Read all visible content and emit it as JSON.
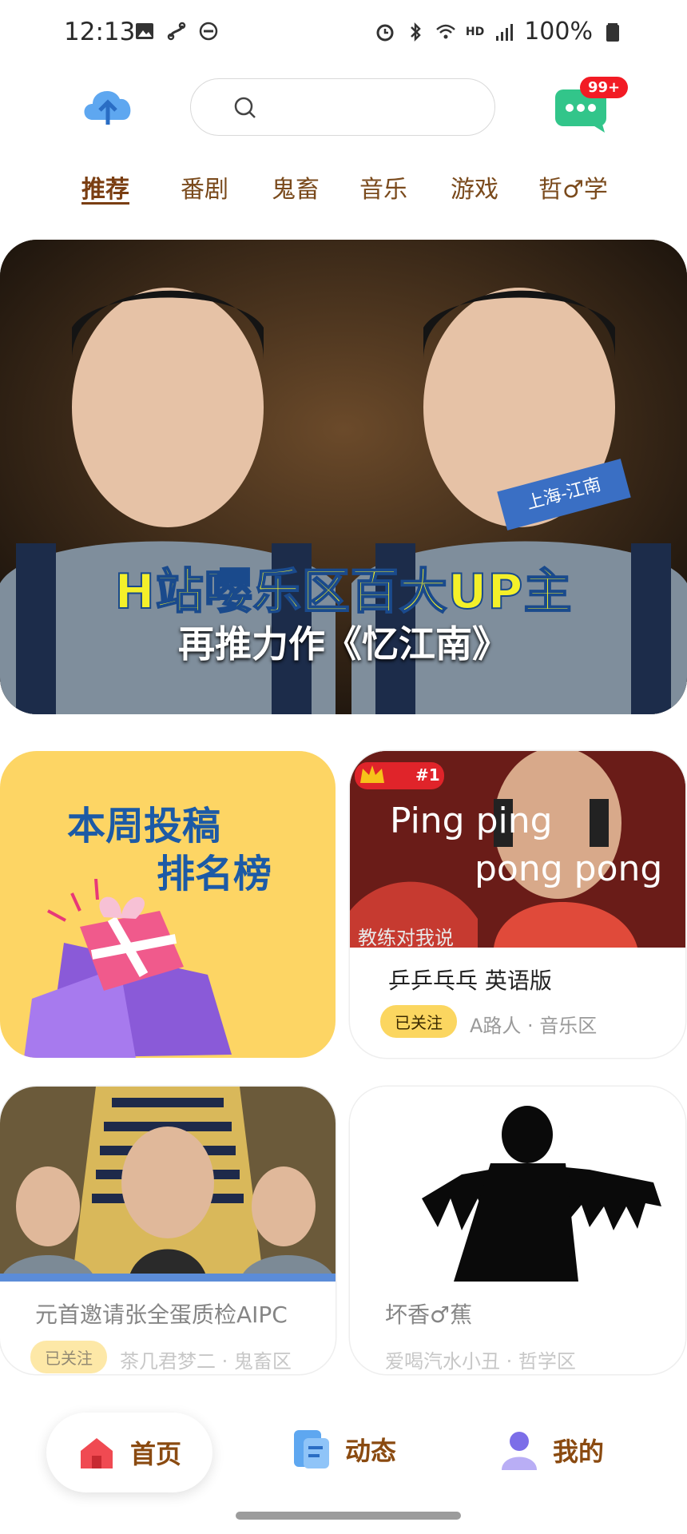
{
  "status_bar": {
    "time": "12:13",
    "network": "HD",
    "battery": "100%"
  },
  "top_bar": {
    "message_badge": "99+"
  },
  "tabs": [
    "推荐",
    "番剧",
    "鬼畜",
    "音乐",
    "游戏",
    "哲♂学"
  ],
  "hero": {
    "line1": "H站嘤乐区百大UP主",
    "line2": "再推力作《忆江南》",
    "tag": "上海-江南"
  },
  "rank_card": {
    "line1": "本周投稿",
    "line2": "排名榜"
  },
  "videos": [
    {
      "thumb_overlay_line1": "Ping ping",
      "thumb_overlay_line2": "pong pong",
      "thumb_caption": "教练对我说",
      "rank": "#1",
      "title": "乒乒乓乓 英语版",
      "follow": "已关注",
      "meta": "A路人 · 音乐区"
    },
    {
      "title": "元首邀请张全蛋质检AIPC",
      "follow": "已关注",
      "meta": "茶几君梦二 · 鬼畜区"
    },
    {
      "title": "坏香♂蕉",
      "meta": "爱喝汽水小丑 · 哲学区"
    }
  ],
  "bottom_nav": [
    {
      "label": "首页"
    },
    {
      "label": "动态"
    },
    {
      "label": "我的"
    }
  ],
  "colors": {
    "accent_brown": "#8a4a10",
    "rank_card_bg": "#fdd564",
    "follow_badge": "#fbd660",
    "badge_red": "#f21b24"
  }
}
